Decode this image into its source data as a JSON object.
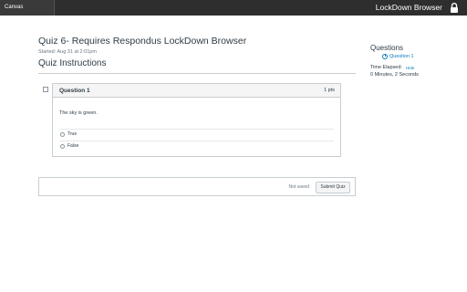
{
  "app": {
    "tab_label": "Canvas",
    "title": "LockDown Browser",
    "lock_icon": "lock-icon"
  },
  "quiz": {
    "title": "Quiz 6- Requires Respondus LockDown Browser",
    "started": "Started: Aug 31 at 2:01pm",
    "instructions_heading": "Quiz Instructions"
  },
  "question": {
    "name": "Question 1",
    "points": "1 pts",
    "text": "The sky is green.",
    "answers": [
      "True",
      "False"
    ]
  },
  "footer": {
    "status": "Not saved",
    "submit_label": "Submit Quiz"
  },
  "sidebar": {
    "heading": "Questions",
    "question_link": "Question 1",
    "time_label": "Time Elapsed:",
    "hide_label": "Hide",
    "time_value": "0 Minutes, 2 Seconds"
  },
  "colors": {
    "topbar": "#2e2e2e",
    "link": "#0a7cbb",
    "text": "#2d3b45",
    "border": "#c7cdd1"
  }
}
